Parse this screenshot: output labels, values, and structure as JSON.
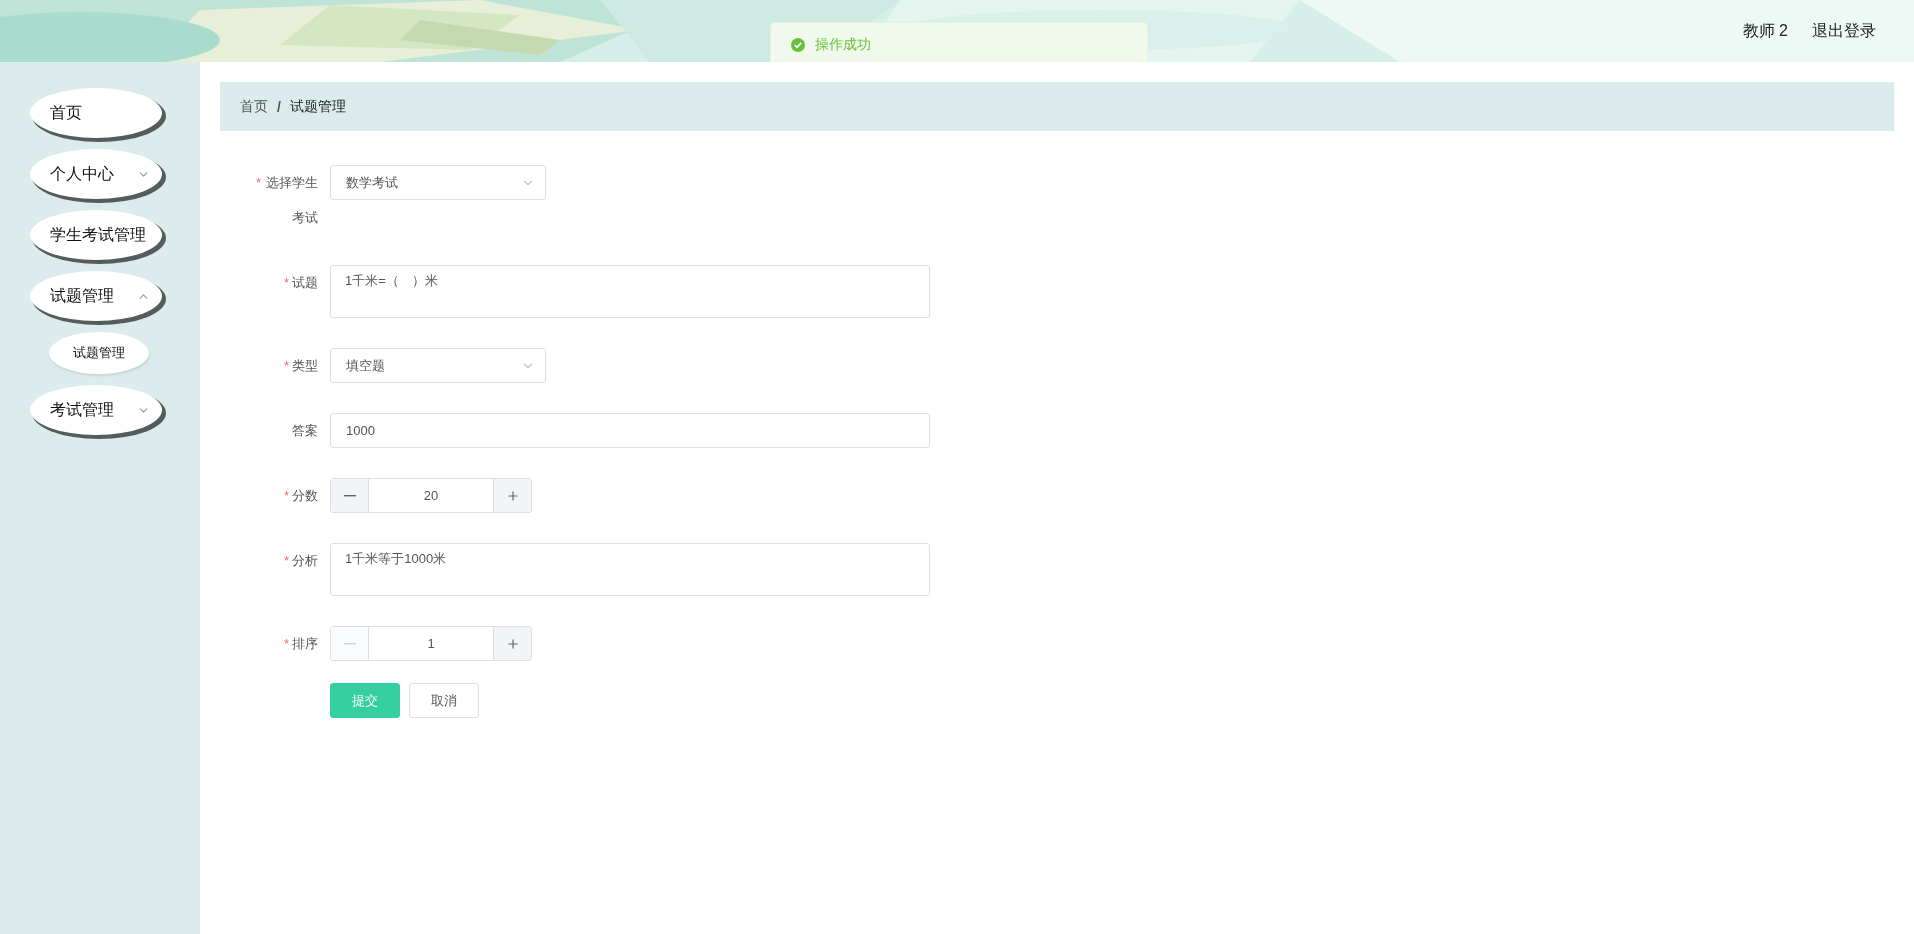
{
  "header": {
    "kind": "picture",
    "user": "教师 2",
    "logout": "退出登录"
  },
  "toast": {
    "kind": "success",
    "message": "操作成功"
  },
  "sidebar": {
    "items": [
      {
        "label": "首页",
        "kind": "link"
      },
      {
        "label": "个人中心",
        "kind": "menu",
        "expanded": false
      },
      {
        "label": "学生考试管理",
        "kind": "link"
      },
      {
        "label": "试题管理",
        "kind": "menu",
        "expanded": true,
        "children": [
          {
            "label": "试题管理"
          }
        ]
      },
      {
        "label": "考试管理",
        "kind": "menu",
        "expanded": false
      }
    ]
  },
  "breadcrumb": {
    "items": [
      "首页",
      "试题管理"
    ],
    "separator": "/"
  },
  "form": {
    "required_mark": "*",
    "fields": [
      {
        "label": "选择学生考试",
        "required": true,
        "kind": "select",
        "value": "数学考试"
      },
      {
        "label": "试题",
        "required": true,
        "kind": "textarea",
        "value": "1千米=（　）米"
      },
      {
        "label": "类型",
        "required": true,
        "kind": "select",
        "value": "填空题"
      },
      {
        "label": "答案",
        "required": false,
        "kind": "input",
        "value": "1000"
      },
      {
        "label": "分数",
        "required": true,
        "kind": "number",
        "value": "20",
        "minus_disabled": false
      },
      {
        "label": "分析",
        "required": true,
        "kind": "textarea",
        "value": "1千米等于1000米"
      },
      {
        "label": "排序",
        "required": true,
        "kind": "number",
        "value": "1",
        "minus_disabled": true
      }
    ],
    "buttons": [
      {
        "label": "提交",
        "kind": "primary"
      },
      {
        "label": "取消",
        "kind": "default"
      }
    ]
  }
}
